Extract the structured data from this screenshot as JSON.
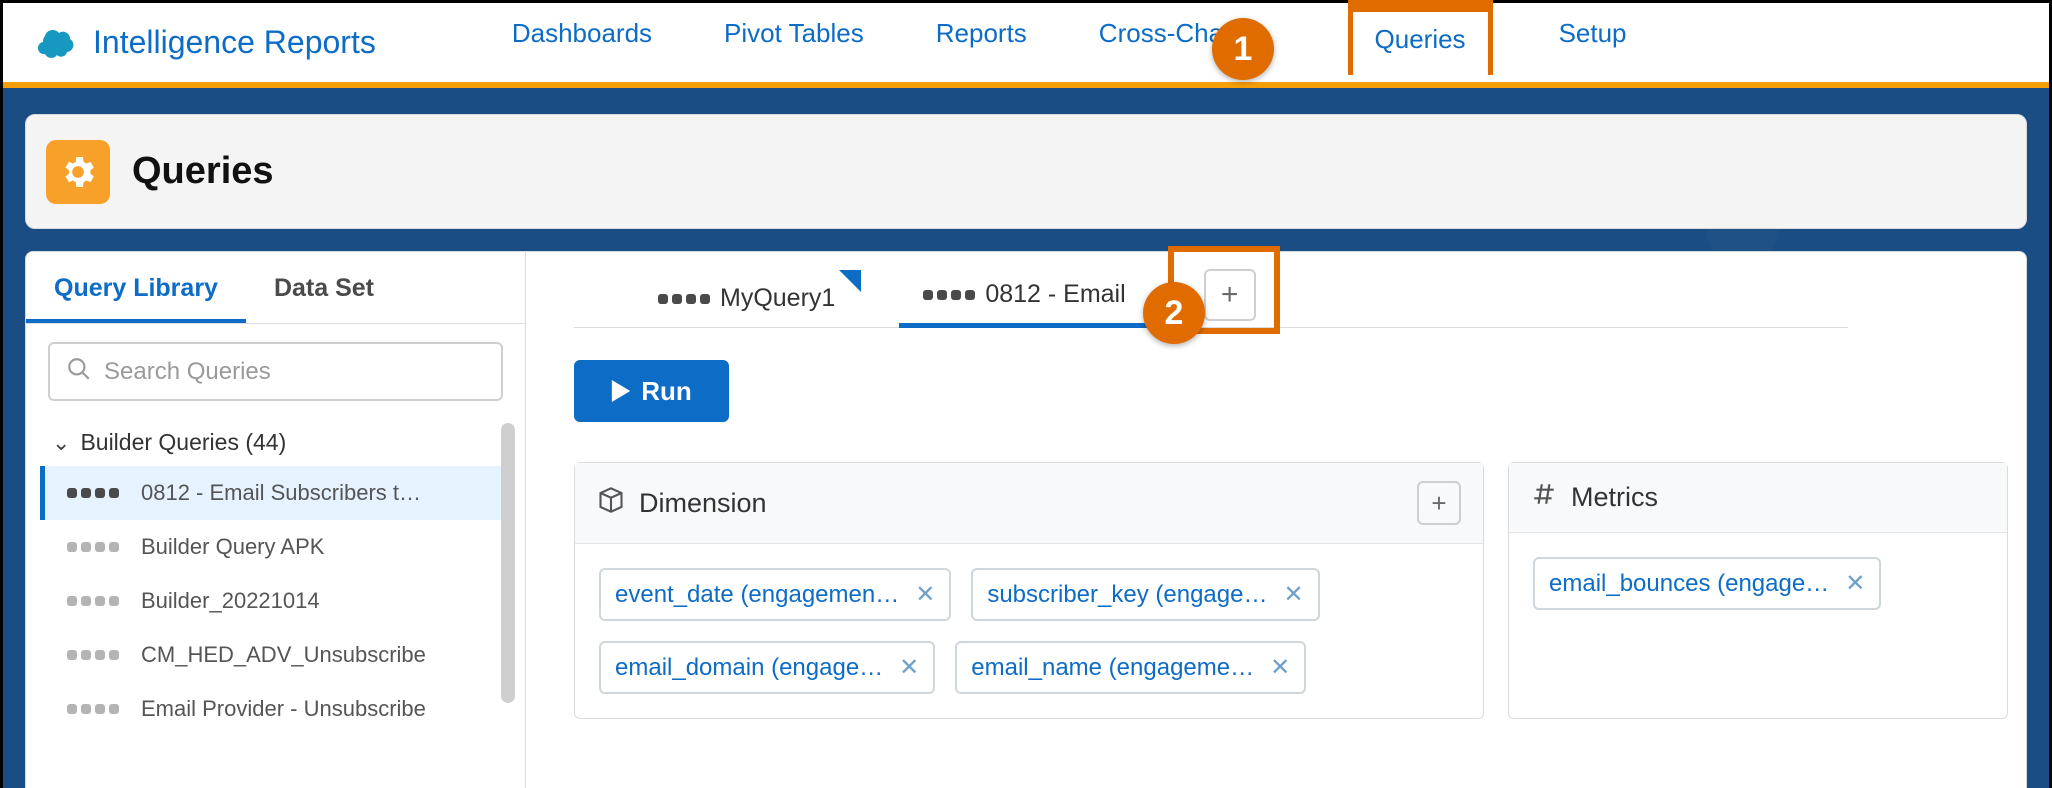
{
  "app": {
    "title": "Intelligence Reports"
  },
  "nav": {
    "items": [
      {
        "label": "Dashboards"
      },
      {
        "label": "Pivot Tables"
      },
      {
        "label": "Reports"
      },
      {
        "label": "Cross-Chan"
      },
      {
        "label": "Queries"
      },
      {
        "label": "Setup"
      }
    ],
    "active_index": 4
  },
  "annotations": {
    "step1": "1",
    "step2": "2"
  },
  "page": {
    "title": "Queries"
  },
  "sidebar": {
    "tabs": [
      {
        "label": "Query Library"
      },
      {
        "label": "Data Set"
      }
    ],
    "active_tab": 0,
    "search_placeholder": "Search Queries",
    "folder_label": "Builder Queries (44)",
    "items": [
      {
        "label": "0812 - Email Subscribers t…",
        "selected": true
      },
      {
        "label": "Builder Query APK"
      },
      {
        "label": "Builder_20221014"
      },
      {
        "label": "CM_HED_ADV_Unsubscribe"
      },
      {
        "label": "Email Provider - Unsubscribe"
      }
    ]
  },
  "queries": {
    "tabs": [
      {
        "label": "MyQuery1",
        "modified": true
      },
      {
        "label": "0812 - Email"
      }
    ],
    "active_tab": 1,
    "run_label": "Run"
  },
  "dimension": {
    "title": "Dimension",
    "chips": [
      "event_date (engagemen…",
      "subscriber_key (engage…",
      "email_domain (engage…",
      "email_name (engageme…"
    ]
  },
  "metrics": {
    "title": "Metrics",
    "chips": [
      "email_bounces (engage…"
    ]
  }
}
